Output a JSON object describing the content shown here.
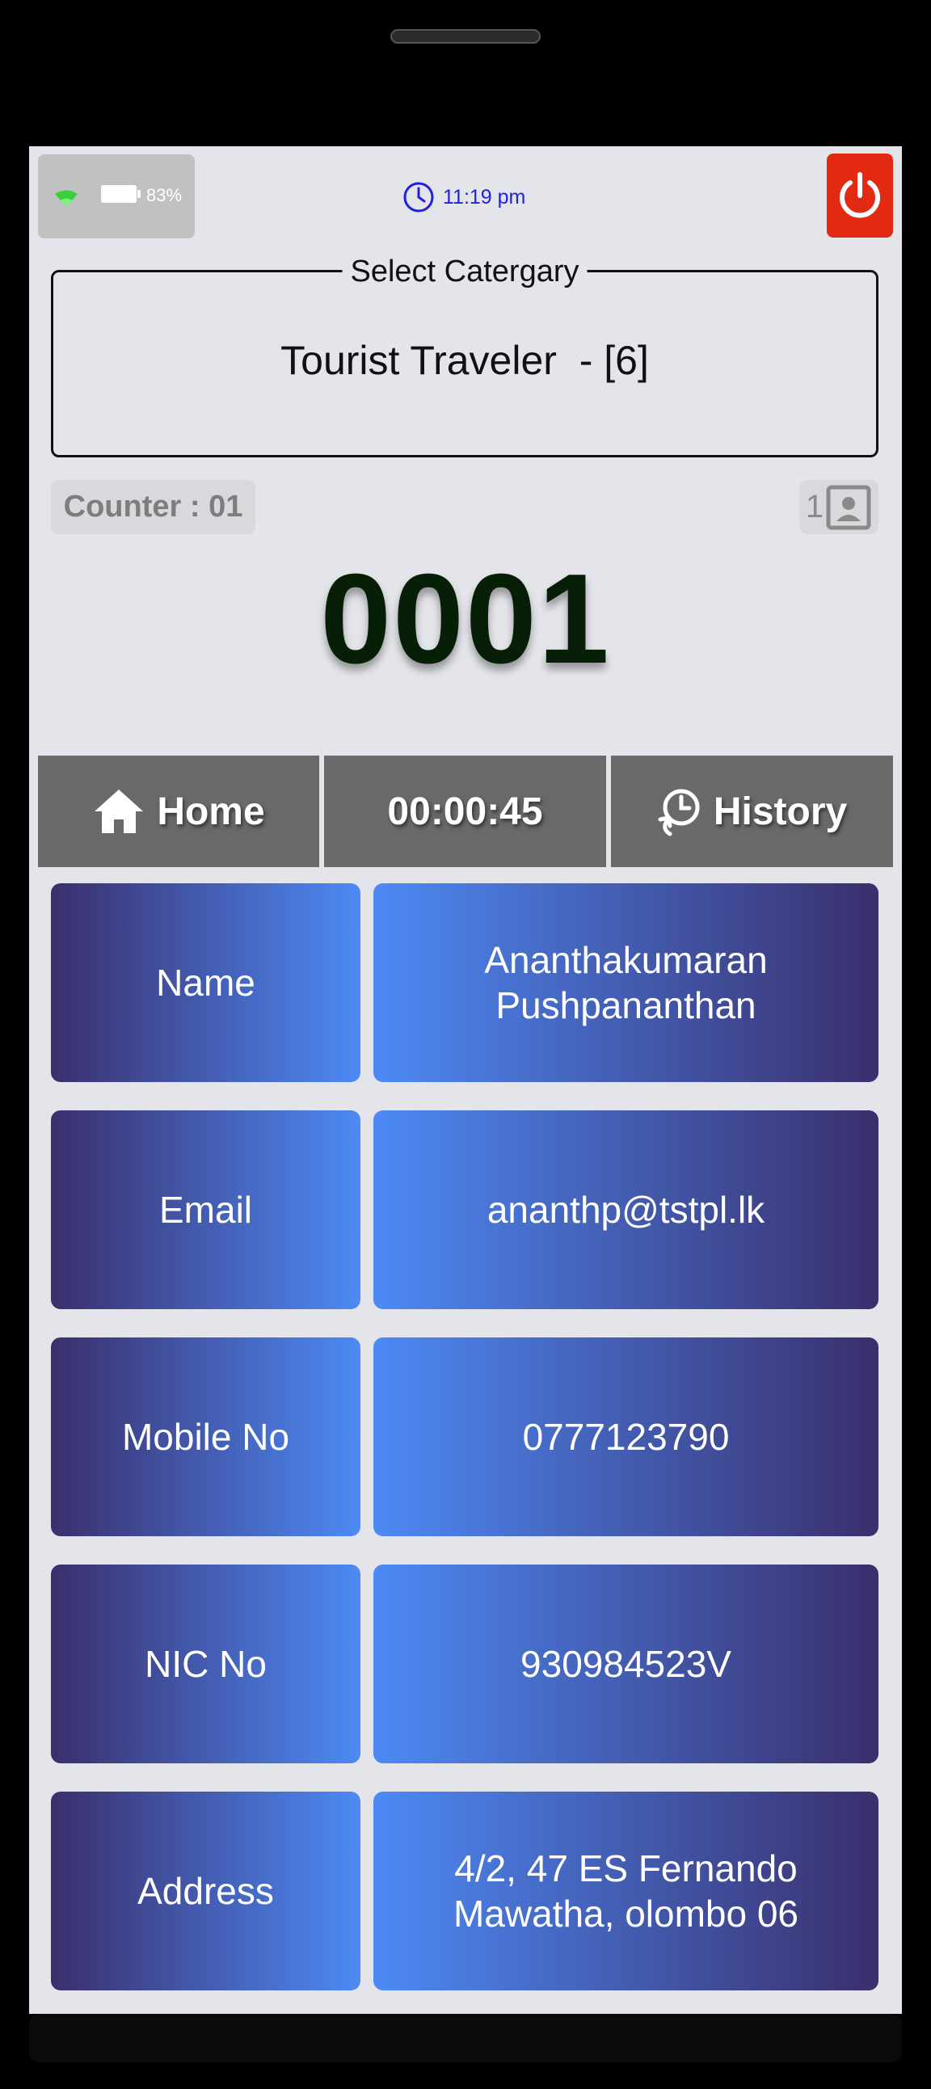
{
  "status_bar": {
    "battery": "83%",
    "time": "11:19 pm"
  },
  "category": {
    "legend": "Select Catergary",
    "selected": "Tourist Traveler  - [6]"
  },
  "counter": {
    "label": "Counter : 01",
    "profile_count": "1"
  },
  "token": {
    "number": "0001"
  },
  "nav": {
    "home_label": "Home",
    "timer": "00:00:45",
    "history_label": "History"
  },
  "details": [
    {
      "label": "Name",
      "value": "Ananthakumaran Pushpananthan"
    },
    {
      "label": "Email",
      "value": "ananthp@tstpl.lk"
    },
    {
      "label": "Mobile No",
      "value": "0777123790"
    },
    {
      "label": "NIC No",
      "value": "930984523V"
    },
    {
      "label": "Address",
      "value": "4/2, 47 ES Fernando Mawatha, olombo 06"
    }
  ],
  "colors": {
    "power": "#e22a12",
    "time": "#2020e0",
    "token": "#061f06",
    "nav_bg": "#6a6868"
  }
}
